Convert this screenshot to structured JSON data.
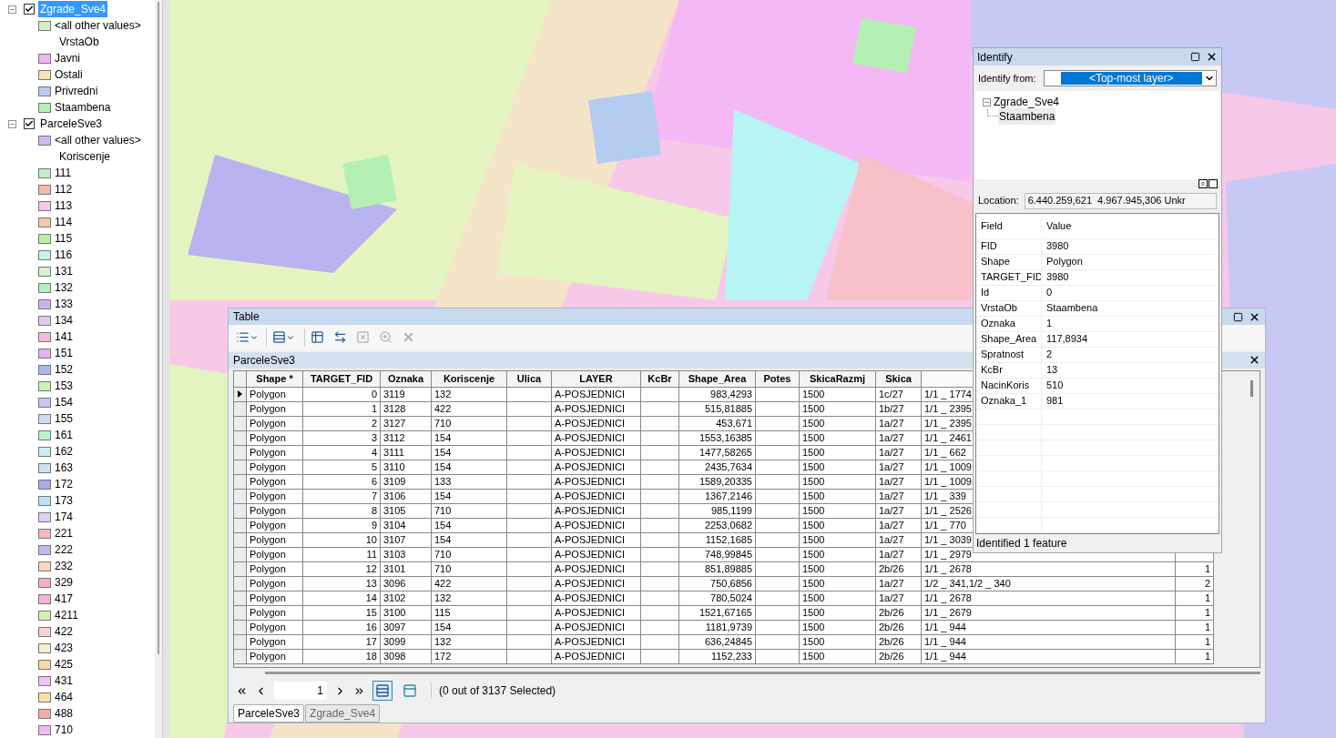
{
  "layers_panel": {
    "layers": [
      {
        "name": "Zgrade_Sve4",
        "checked": true,
        "expanded": true,
        "selected": true,
        "legend": [
          {
            "kind": "swatch",
            "label": "<all other values>",
            "color": "#d8f0c0"
          },
          {
            "kind": "heading",
            "label": "VrstaOb"
          },
          {
            "kind": "swatch",
            "label": "Javni",
            "color": "#f0b4f0"
          },
          {
            "kind": "swatch",
            "label": "Ostali",
            "color": "#f8e0b8"
          },
          {
            "kind": "swatch",
            "label": "Privredni",
            "color": "#b4ccf0"
          },
          {
            "kind": "swatch",
            "label": "Staambena",
            "color": "#b4f0b4"
          }
        ]
      },
      {
        "name": "ParceleSve3",
        "checked": true,
        "expanded": true,
        "selected": false,
        "legend": [
          {
            "kind": "swatch",
            "label": "<all other values>",
            "color": "#d0b8f0"
          },
          {
            "kind": "heading",
            "label": "Koriscenje"
          },
          {
            "kind": "swatch",
            "label": "111",
            "color": "#c0f0c8"
          },
          {
            "kind": "swatch",
            "label": "112",
            "color": "#f4b8a8"
          },
          {
            "kind": "swatch",
            "label": "113",
            "color": "#f8c8e8"
          },
          {
            "kind": "swatch",
            "label": "114",
            "color": "#f8c8a8"
          },
          {
            "kind": "swatch",
            "label": "115",
            "color": "#b8f0a0"
          },
          {
            "kind": "swatch",
            "label": "116",
            "color": "#c8f4e8"
          },
          {
            "kind": "swatch",
            "label": "131",
            "color": "#d8f4c8"
          },
          {
            "kind": "swatch",
            "label": "132",
            "color": "#b0f0c0"
          },
          {
            "kind": "swatch",
            "label": "133",
            "color": "#d0b0f4"
          },
          {
            "kind": "swatch",
            "label": "134",
            "color": "#e0c8f4"
          },
          {
            "kind": "swatch",
            "label": "141",
            "color": "#f8b8d8"
          },
          {
            "kind": "swatch",
            "label": "151",
            "color": "#e8b0f0"
          },
          {
            "kind": "swatch",
            "label": "152",
            "color": "#a8b8f0"
          },
          {
            "kind": "swatch",
            "label": "153",
            "color": "#c8f4b8"
          },
          {
            "kind": "swatch",
            "label": "154",
            "color": "#c8c8f4"
          },
          {
            "kind": "swatch",
            "label": "155",
            "color": "#c8dcf4"
          },
          {
            "kind": "swatch",
            "label": "161",
            "color": "#b8f4d0"
          },
          {
            "kind": "swatch",
            "label": "162",
            "color": "#c8f0f4"
          },
          {
            "kind": "swatch",
            "label": "163",
            "color": "#c8e4f4"
          },
          {
            "kind": "swatch",
            "label": "172",
            "color": "#a8a8ec"
          },
          {
            "kind": "swatch",
            "label": "173",
            "color": "#b8e4f8"
          },
          {
            "kind": "swatch",
            "label": "174",
            "color": "#e0d0f4"
          },
          {
            "kind": "swatch",
            "label": "221",
            "color": "#f8b8b8"
          },
          {
            "kind": "swatch",
            "label": "222",
            "color": "#c4b8f4"
          },
          {
            "kind": "swatch",
            "label": "232",
            "color": "#f8d8b8"
          },
          {
            "kind": "swatch",
            "label": "329",
            "color": "#f4b0c0"
          },
          {
            "kind": "swatch",
            "label": "417",
            "color": "#f4b0e0"
          },
          {
            "kind": "swatch",
            "label": "4211",
            "color": "#ccf4b0"
          },
          {
            "kind": "swatch",
            "label": "422",
            "color": "#f8d4d4"
          },
          {
            "kind": "swatch",
            "label": "423",
            "color": "#f8ecd0"
          },
          {
            "kind": "swatch",
            "label": "425",
            "color": "#f8d8a0"
          },
          {
            "kind": "swatch",
            "label": "431",
            "color": "#f4c0f4"
          },
          {
            "kind": "swatch",
            "label": "464",
            "color": "#f8e0a0"
          },
          {
            "kind": "swatch",
            "label": "488",
            "color": "#f4aca8"
          },
          {
            "kind": "swatch",
            "label": "710",
            "color": "#f4b8f4"
          }
        ]
      }
    ]
  },
  "table_window": {
    "title": "Table",
    "toolbar": [
      {
        "kind": "options",
        "disabled": false
      },
      {
        "kind": "related",
        "disabled": false
      },
      {
        "kind": "select",
        "disabled": false
      },
      {
        "kind": "switch",
        "disabled": false
      },
      {
        "kind": "clear",
        "disabled": true
      },
      {
        "kind": "zoom",
        "disabled": true
      },
      {
        "kind": "delete",
        "disabled": true
      }
    ],
    "table_title": "ParceleSve3",
    "columns": [
      "Shape *",
      "TARGET_FID",
      "Oznaka",
      "Koriscenje",
      "Ulica",
      "LAYER",
      "KcBr",
      "Shape_Area",
      "Potes",
      "SkicaRazmj",
      "Skica"
    ],
    "rows": [
      {
        "current": true,
        "shape": "Polygon",
        "target_fid": "0",
        "oznaka": "3119",
        "koriscenje": "132",
        "layer": "A-POSJEDNICI",
        "shape_area": "983,4293",
        "skica_razmj": "1500",
        "skica": "1c/27",
        "column_12": "1/1 _ 1774"
      },
      {
        "current": false,
        "shape": "Polygon",
        "target_fid": "1",
        "oznaka": "3128",
        "koriscenje": "422",
        "layer": "A-POSJEDNICI",
        "shape_area": "515,81885",
        "skica_razmj": "1500",
        "skica": "1b/27",
        "column_12": "1/1 _ 2395"
      },
      {
        "current": false,
        "shape": "Polygon",
        "target_fid": "2",
        "oznaka": "3127",
        "koriscenje": "710",
        "layer": "A-POSJEDNICI",
        "shape_area": "453,671",
        "skica_razmj": "1500",
        "skica": "1a/27",
        "column_12": "1/1 _ 2395"
      },
      {
        "current": false,
        "shape": "Polygon",
        "target_fid": "3",
        "oznaka": "3112",
        "koriscenje": "154",
        "layer": "A-POSJEDNICI",
        "shape_area": "1553,16385",
        "skica_razmj": "1500",
        "skica": "1a/27",
        "column_12": "1/1 _ 2461"
      },
      {
        "current": false,
        "shape": "Polygon",
        "target_fid": "4",
        "oznaka": "3111",
        "koriscenje": "154",
        "layer": "A-POSJEDNICI",
        "shape_area": "1477,58265",
        "skica_razmj": "1500",
        "skica": "1a/27",
        "column_12": "1/1 _ 662"
      },
      {
        "current": false,
        "shape": "Polygon",
        "target_fid": "5",
        "oznaka": "3110",
        "koriscenje": "154",
        "layer": "A-POSJEDNICI",
        "shape_area": "2435,7634",
        "skica_razmj": "1500",
        "skica": "1a/27",
        "column_12": "1/1 _ 1009"
      },
      {
        "current": false,
        "shape": "Polygon",
        "target_fid": "6",
        "oznaka": "3109",
        "koriscenje": "133",
        "layer": "A-POSJEDNICI",
        "shape_area": "1589,20335",
        "skica_razmj": "1500",
        "skica": "1a/27",
        "column_12": "1/1 _ 1009"
      },
      {
        "current": false,
        "shape": "Polygon",
        "target_fid": "7",
        "oznaka": "3106",
        "koriscenje": "154",
        "layer": "A-POSJEDNICI",
        "shape_area": "1367,2146",
        "skica_razmj": "1500",
        "skica": "1a/27",
        "column_12": "1/1 _ 339"
      },
      {
        "current": false,
        "shape": "Polygon",
        "target_fid": "8",
        "oznaka": "3105",
        "koriscenje": "710",
        "layer": "A-POSJEDNICI",
        "shape_area": "985,1199",
        "skica_razmj": "1500",
        "skica": "1a/27",
        "column_12": "1/1 _ 2526"
      },
      {
        "current": false,
        "shape": "Polygon",
        "target_fid": "9",
        "oznaka": "3104",
        "koriscenje": "154",
        "layer": "A-POSJEDNICI",
        "shape_area": "2253,0682",
        "skica_razmj": "1500",
        "skica": "1a/27",
        "column_12": "1/1 _ 770"
      },
      {
        "current": false,
        "shape": "Polygon",
        "target_fid": "10",
        "oznaka": "3107",
        "koriscenje": "154",
        "layer": "A-POSJEDNICI",
        "shape_area": "1152,1685",
        "skica_razmj": "1500",
        "skica": "1a/27",
        "column_12": "1/1 _ 3039"
      },
      {
        "current": false,
        "shape": "Polygon",
        "target_fid": "11",
        "oznaka": "3103",
        "koriscenje": "710",
        "layer": "A-POSJEDNICI",
        "shape_area": "748,99845",
        "skica_razmj": "1500",
        "skica": "1a/27",
        "column_12": "1/1 _ 2979"
      },
      {
        "current": false,
        "shape": "Polygon",
        "target_fid": "12",
        "oznaka": "3101",
        "koriscenje": "710",
        "layer": "A-POSJEDNICI",
        "shape_area": "851,89885",
        "skica_razmj": "1500",
        "skica": "2b/26",
        "column_12": "1/1 _ 2678",
        "column_13": "1"
      },
      {
        "current": false,
        "shape": "Polygon",
        "target_fid": "13",
        "oznaka": "3096",
        "koriscenje": "422",
        "layer": "A-POSJEDNICI",
        "shape_area": "750,6856",
        "skica_razmj": "1500",
        "skica": "1a/27",
        "column_12": "1/2 _ 341,1/2 _ 340",
        "column_13": "2"
      },
      {
        "current": false,
        "shape": "Polygon",
        "target_fid": "14",
        "oznaka": "3102",
        "koriscenje": "132",
        "layer": "A-POSJEDNICI",
        "shape_area": "780,5024",
        "skica_razmj": "1500",
        "skica": "1a/27",
        "column_12": "1/1 _ 2678",
        "column_13": "1"
      },
      {
        "current": false,
        "shape": "Polygon",
        "target_fid": "15",
        "oznaka": "3100",
        "koriscenje": "115",
        "layer": "A-POSJEDNICI",
        "shape_area": "1521,67165",
        "skica_razmj": "1500",
        "skica": "2b/26",
        "column_12": "1/1 _ 2679",
        "column_13": "1"
      },
      {
        "current": false,
        "shape": "Polygon",
        "target_fid": "16",
        "oznaka": "3097",
        "koriscenje": "154",
        "layer": "A-POSJEDNICI",
        "shape_area": "1181,9739",
        "skica_razmj": "1500",
        "skica": "2b/26",
        "column_12": "1/1 _ 944",
        "column_13": "1"
      },
      {
        "current": false,
        "shape": "Polygon",
        "target_fid": "17",
        "oznaka": "3099",
        "koriscenje": "132",
        "layer": "A-POSJEDNICI",
        "shape_area": "636,24845",
        "skica_razmj": "1500",
        "skica": "2b/26",
        "column_12": "1/1 _ 944",
        "column_13": "1"
      },
      {
        "current": false,
        "shape": "Polygon",
        "target_fid": "18",
        "oznaka": "3098",
        "koriscenje": "172",
        "layer": "A-POSJEDNICI",
        "shape_area": "1152,233",
        "skica_razmj": "1500",
        "skica": "2b/26",
        "column_12": "1/1 _ 944",
        "column_13": "1"
      }
    ],
    "record_field": "1",
    "view_buttons": [
      {
        "kind": "all",
        "selected": true
      },
      {
        "kind": "selected",
        "selected": false
      }
    ],
    "selection_status": "(0 out of 3137 Selected)",
    "tabs": [
      {
        "label": "ParceleSve3",
        "selected": true
      },
      {
        "label": "Zgrade_Sve4",
        "selected": false
      }
    ]
  },
  "identify": {
    "title": "Identify",
    "from_label": "Identify from:",
    "from_value": "<Top-most layer>",
    "tree": [
      {
        "label": "Zgrade_Sve4",
        "expanded": true,
        "children": [
          {
            "label": "Staambena",
            "selected": true
          }
        ]
      }
    ],
    "location_label": "Location:",
    "location_value": "6.440.259,621  4.967.945,306 Unkr",
    "field_header": "Field",
    "value_header": "Value",
    "attributes": [
      {
        "field": "FID",
        "value": "3980"
      },
      {
        "field": "Shape",
        "value": "Polygon"
      },
      {
        "field": "TARGET_FID",
        "value": "3980"
      },
      {
        "field": "Id",
        "value": "0"
      },
      {
        "field": "VrstaOb",
        "value": "Staambena"
      },
      {
        "field": "Oznaka",
        "value": "1"
      },
      {
        "field": "Shape_Area",
        "value": "117,8934"
      },
      {
        "field": "Spratnost",
        "value": "2"
      },
      {
        "field": "KcBr",
        "value": "13"
      },
      {
        "field": "NacinKoris",
        "value": "510"
      },
      {
        "field": "Oznaka_1",
        "value": "981"
      }
    ],
    "status": "Identified 1 feature"
  }
}
